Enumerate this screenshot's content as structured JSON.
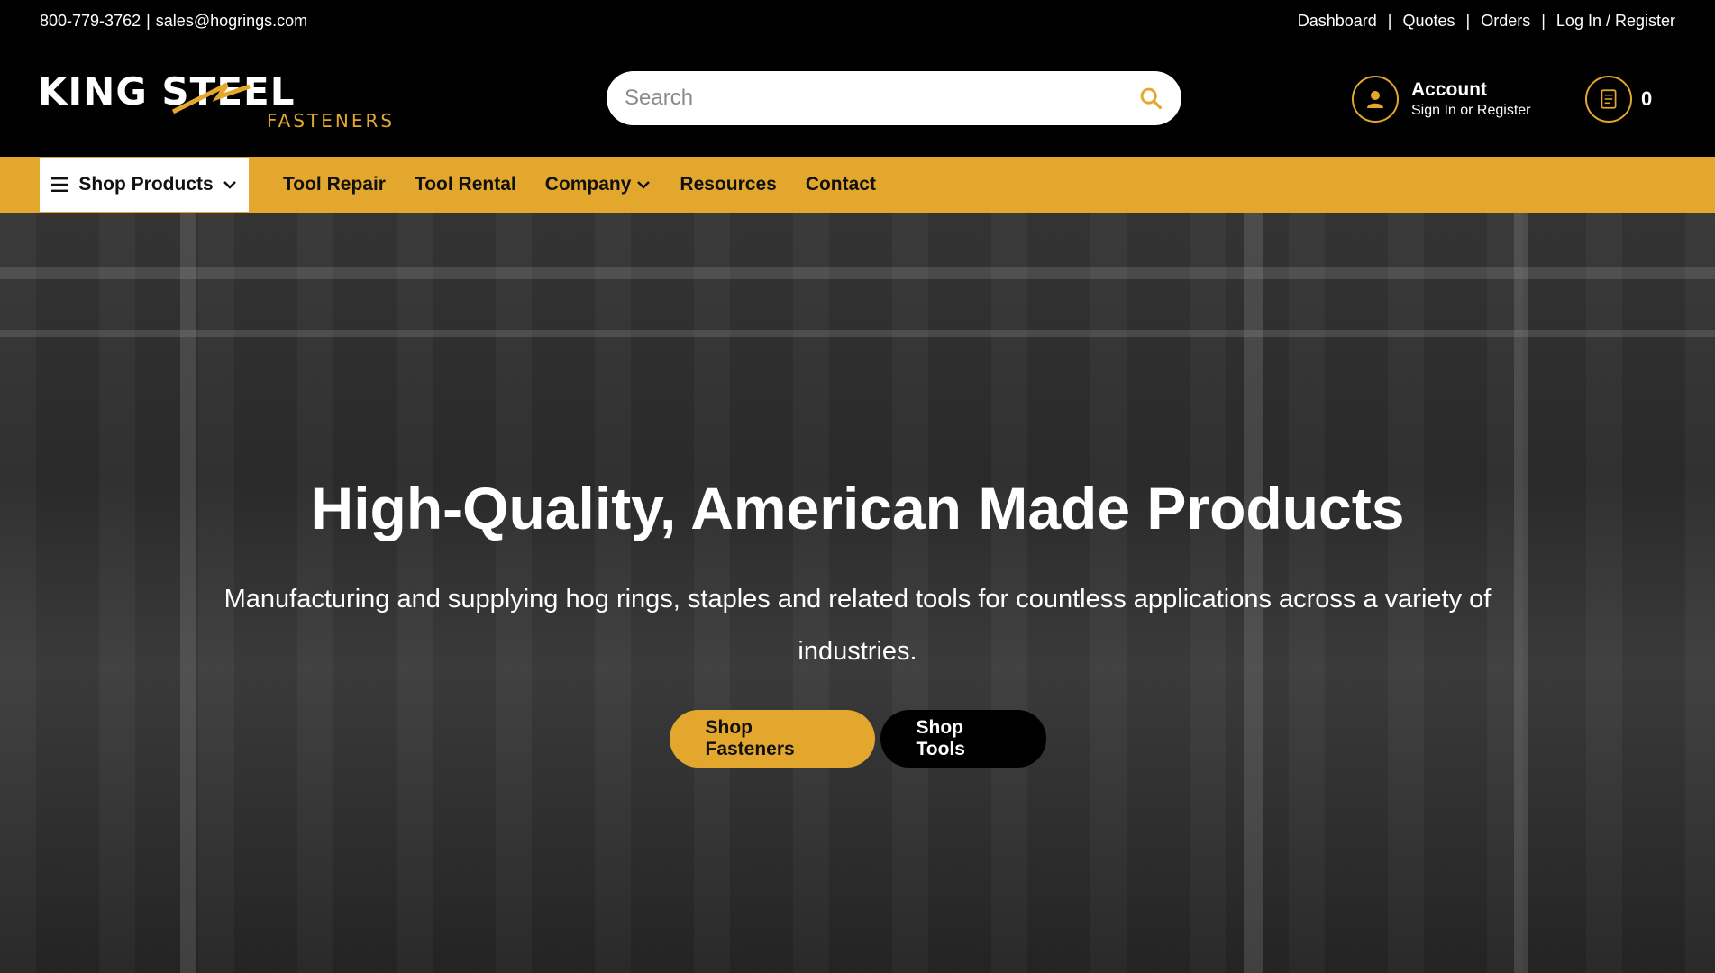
{
  "topbar": {
    "phone": "800-779-3762",
    "divider": "|",
    "email": "sales@hogrings.com",
    "links": [
      "Dashboard",
      "Quotes",
      "Orders",
      "Log In / Register"
    ]
  },
  "header": {
    "logo_text": "KING STEEL",
    "logo_sub": "FASTENERS",
    "search_placeholder": "Search",
    "account_title": "Account",
    "account_sub": "Sign In or Register",
    "cart_count": "0"
  },
  "nav": {
    "shop_products": "Shop Products",
    "items": [
      "Tool Repair",
      "Tool Rental",
      "Company",
      "Resources",
      "Contact"
    ]
  },
  "hero": {
    "title": "High-Quality, American Made Products",
    "subtitle": "Manufacturing and supplying hog rings, staples and related tools for countless applications across a variety of industries.",
    "btn_fasteners": "Shop Fasteners",
    "btn_tools": "Shop Tools"
  },
  "colors": {
    "accent": "#e3a72d",
    "background": "#000000"
  }
}
